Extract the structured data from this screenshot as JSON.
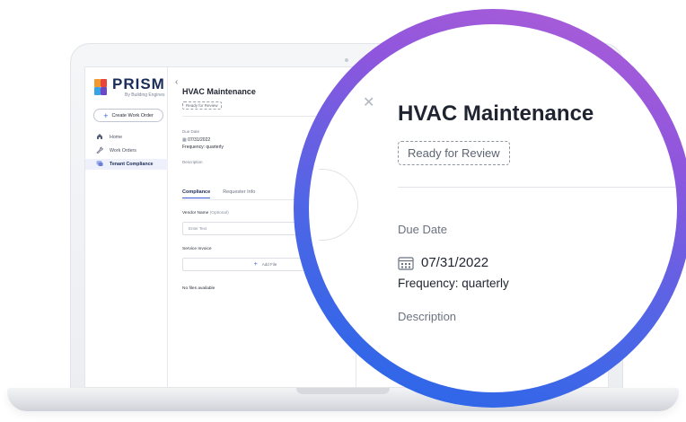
{
  "app": {
    "brand": "PRISM",
    "brand_subtitle": "By Building Engines",
    "collapse_icon": "chevron-left-icon"
  },
  "sidebar": {
    "create_button_label": "Create Work Order",
    "items": [
      {
        "label": "Home",
        "icon": "home-icon",
        "active": false
      },
      {
        "label": "Work Orders",
        "icon": "wrench-icon",
        "active": false
      },
      {
        "label": "Tenant Compliance",
        "icon": "chat-icon",
        "active": true
      }
    ]
  },
  "detail": {
    "title": "HVAC Maintenance",
    "status": "Ready for Review",
    "due_date_label": "Due Date",
    "due_date": "07/31/2022",
    "frequency": "Frequency: quarterly",
    "description_label": "Description",
    "tabs": [
      {
        "label": "Compliance",
        "active": true
      },
      {
        "label": "Requester Info",
        "active": false
      }
    ],
    "vendor_label": "Vendor Name",
    "vendor_optional": "(Optional)",
    "vendor_placeholder": "Enter Text",
    "invoice_label": "Service Invoice",
    "add_file_label": "Add File",
    "no_files_text": "No files available"
  },
  "colors": {
    "accent": "#3a5bd9",
    "magnifier_ring_start": "#b15ed6",
    "magnifier_ring_end": "#2367e9",
    "active_nav_bg": "#eef1fb"
  }
}
